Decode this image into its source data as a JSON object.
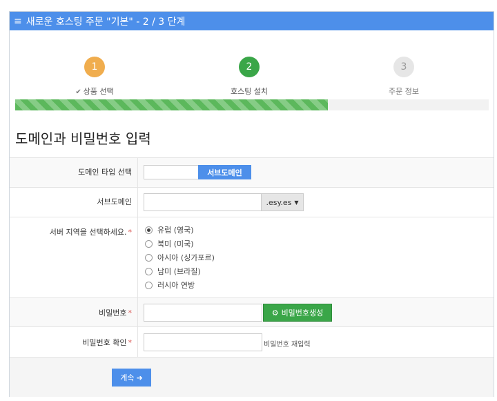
{
  "header": {
    "title": "새로운 호스팅 주문 \"기본\" - 2 / 3 단계"
  },
  "steps": [
    {
      "number": "1",
      "label": "상품 선택"
    },
    {
      "number": "2",
      "label": "호스팅 설치"
    },
    {
      "number": "3",
      "label": "주문 정보"
    }
  ],
  "progress": {
    "percent": 66
  },
  "section": {
    "title": "도메인과 비밀번호 입력"
  },
  "form": {
    "domain_type": {
      "label": "도메인 타입 선택",
      "button": "서브도메인"
    },
    "subdomain": {
      "label": "서브도메인",
      "value": "",
      "suffix": ".esy.es"
    },
    "region": {
      "label": "서버 지역을 선택하세요.",
      "required": "*",
      "options": [
        "유럽 (영국)",
        "북미 (미국)",
        "아시아 (싱가포르)",
        "남미 (브라질)",
        "러시아 연방"
      ],
      "selected_index": 0
    },
    "password": {
      "label": "비밀번호",
      "required": "*",
      "value": "",
      "generate_button": "비밀번호생성"
    },
    "password_confirm": {
      "label": "비밀번호 확인",
      "required": "*",
      "value": "",
      "hint": "비밀번호 재입력"
    }
  },
  "footer": {
    "continue_label": "계속"
  },
  "colors": {
    "primary": "#4d8fea",
    "success": "#3aa648",
    "warning": "#f0ad4e"
  }
}
